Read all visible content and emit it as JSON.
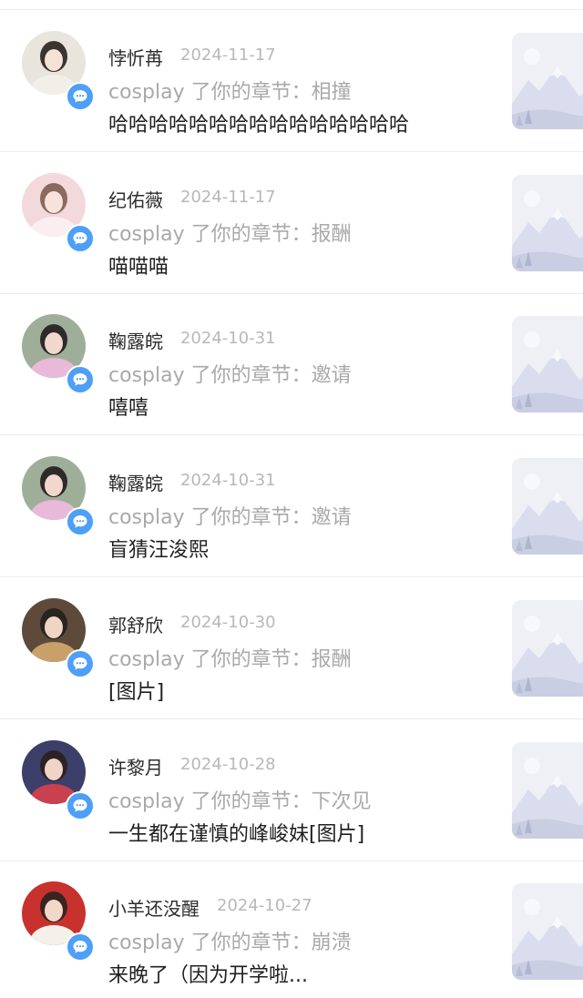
{
  "activity_prefix": "cosplay 了你的章节：",
  "items": [
    {
      "name": "悖忻苒",
      "date": "2024-11-17",
      "chapter": "相撞",
      "comment": "哈哈哈哈哈哈哈哈哈哈哈哈哈哈哈",
      "avatar_icon": "user-avatar",
      "badge_icon": "comment-bubble-icon"
    },
    {
      "name": "纪佑薇",
      "date": "2024-11-17",
      "chapter": "报酬",
      "comment": "喵喵喵",
      "avatar_icon": "user-avatar",
      "badge_icon": "comment-bubble-icon"
    },
    {
      "name": "鞠露皖",
      "date": "2024-10-31",
      "chapter": "邀请",
      "comment": "嘻嘻",
      "avatar_icon": "user-avatar",
      "badge_icon": "comment-bubble-icon"
    },
    {
      "name": "鞠露皖",
      "date": "2024-10-31",
      "chapter": "邀请",
      "comment": "盲猜汪浚熙",
      "avatar_icon": "user-avatar",
      "badge_icon": "comment-bubble-icon"
    },
    {
      "name": "郭舒欣",
      "date": "2024-10-30",
      "chapter": "报酬",
      "comment": "[图片]",
      "avatar_icon": "user-avatar",
      "badge_icon": "comment-bubble-icon"
    },
    {
      "name": "许黎月",
      "date": "2024-10-28",
      "chapter": "下次见",
      "comment": "一生都在谨慎的峰峻妹[图片]",
      "avatar_icon": "user-avatar",
      "badge_icon": "comment-bubble-icon"
    },
    {
      "name": "小羊还没醒",
      "date": "2024-10-27",
      "chapter": "崩溃",
      "comment": "来晚了（因为开学啦...",
      "avatar_icon": "user-avatar",
      "badge_icon": "comment-bubble-icon"
    }
  ],
  "thumbnail_icon": "mountain-placeholder-icon",
  "colors": {
    "badge": "#4d9ff7",
    "name": "#2b2b2b",
    "date": "#b8b8b8",
    "activity": "#a9a9a9",
    "comment": "#1f1f1f",
    "thumb_bg": "#eef0f6"
  }
}
